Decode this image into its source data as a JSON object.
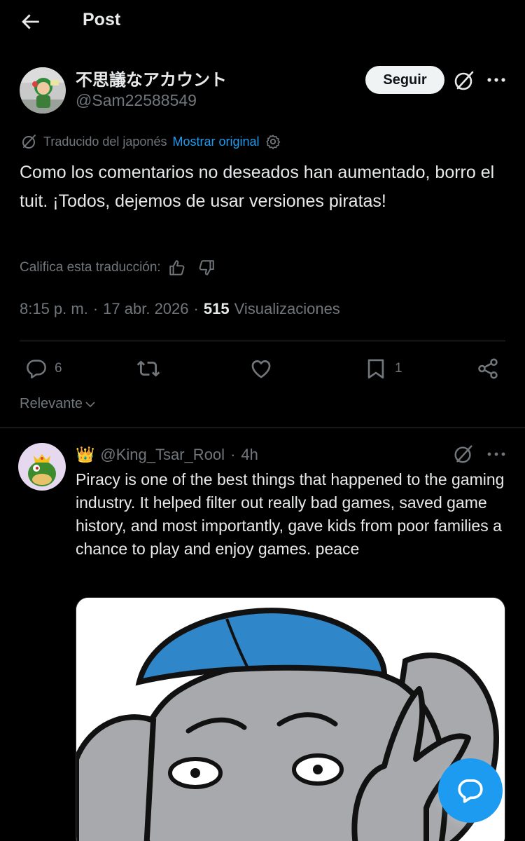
{
  "header": {
    "title": "Post"
  },
  "post": {
    "author": {
      "display_name": "不思議なアカウント",
      "handle": "@Sam22588549"
    },
    "follow_label": "Seguir",
    "translation": {
      "label": "Traducido del japonés",
      "show_original": "Mostrar original"
    },
    "text": "Como los comentarios no deseados han aumentado, borro el tuit. ¡Todos, dejemos de usar versiones piratas!",
    "rate_label": "Califica esta traducción:",
    "meta": {
      "time": "8:15 p. m.",
      "sep1": "·",
      "date": "17 abr. 2026",
      "sep2": "·",
      "views_count": "515",
      "views_label": "Visualizaciones"
    },
    "actions": {
      "replies": "6",
      "reposts": "",
      "likes": "",
      "bookmarks": "1"
    },
    "sort_label": "Relevante"
  },
  "reply": {
    "badge": "👑",
    "handle": "@King_Tsar_Rool",
    "sep": "·",
    "time": "4h",
    "text": "Piracy is one of the best things that happened to the gaming industry. It helped filter out really bad games, saved game history, and most importantly, gave kids from poor families a chance to play and enjoy games. peace"
  },
  "icons": {
    "back": "arrow-left-icon",
    "grok": "grok-icon",
    "more": "more-dots-icon",
    "translate": "translate-icon",
    "settings": "gear-icon",
    "thumbs_up": "thumbs-up-icon",
    "thumbs_down": "thumbs-down-icon",
    "reply": "reply-icon",
    "repost": "repost-icon",
    "like": "heart-icon",
    "bookmark": "bookmark-icon",
    "share": "share-icon",
    "compose": "compose-reply-icon"
  },
  "colors": {
    "background": "#000000",
    "text": "#e7e9ea",
    "muted": "#71767b",
    "accent": "#1d9bf0",
    "divider": "#2f3336",
    "follow_bg": "#eff3f4"
  }
}
